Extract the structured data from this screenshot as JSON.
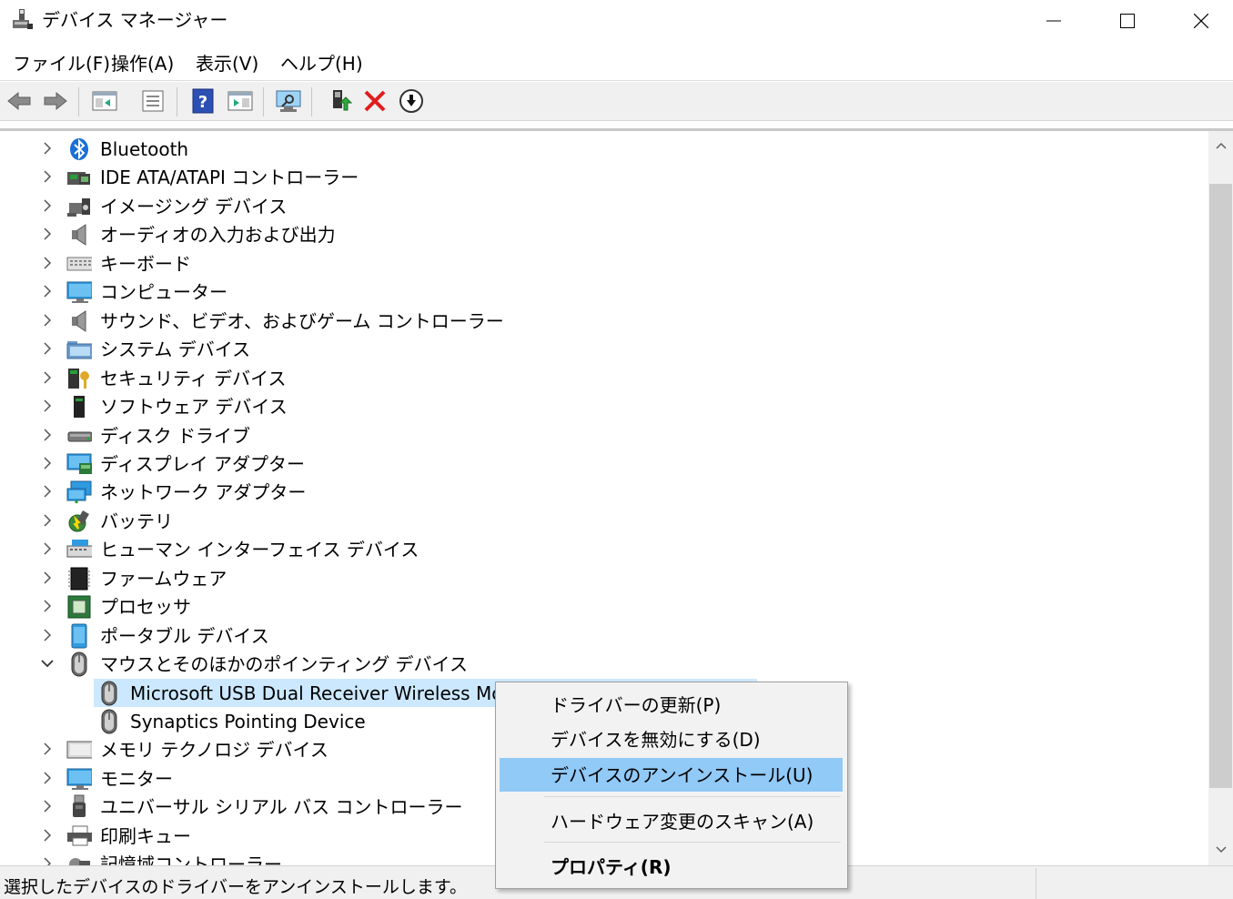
{
  "window": {
    "title": "デバイス マネージャー"
  },
  "menu": [
    "ファイル(F)",
    "操作(A)",
    "表示(V)",
    "ヘルプ(H)"
  ],
  "toolbar": {
    "icons": [
      "back-icon",
      "forward-icon",
      "show-hide-console-tree-icon",
      "properties-icon",
      "help-icon",
      "action-pane-icon",
      "scan-hardware-icon",
      "update-driver-icon",
      "uninstall-icon",
      "disable-device-icon"
    ]
  },
  "tree": {
    "items": [
      {
        "label": "Bluetooth",
        "icon": "bluetooth-icon"
      },
      {
        "label": "IDE ATA/ATAPI コントローラー",
        "icon": "ide-controller-icon"
      },
      {
        "label": "イメージング デバイス",
        "icon": "camera-icon"
      },
      {
        "label": "オーディオの入力および出力",
        "icon": "speaker-icon"
      },
      {
        "label": "キーボード",
        "icon": "keyboard-icon"
      },
      {
        "label": "コンピューター",
        "icon": "computer-icon"
      },
      {
        "label": "サウンド、ビデオ、およびゲーム コントローラー",
        "icon": "speaker-icon"
      },
      {
        "label": "システム デバイス",
        "icon": "system-folder-icon"
      },
      {
        "label": "セキュリティ デバイス",
        "icon": "security-key-icon"
      },
      {
        "label": "ソフトウェア デバイス",
        "icon": "software-device-icon"
      },
      {
        "label": "ディスク ドライブ",
        "icon": "disk-drive-icon"
      },
      {
        "label": "ディスプレイ アダプター",
        "icon": "display-adapter-icon"
      },
      {
        "label": "ネットワーク アダプター",
        "icon": "network-adapter-icon"
      },
      {
        "label": "バッテリ",
        "icon": "battery-icon"
      },
      {
        "label": "ヒューマン インターフェイス デバイス",
        "icon": "hid-icon"
      },
      {
        "label": "ファームウェア",
        "icon": "firmware-chip-icon"
      },
      {
        "label": "プロセッサ",
        "icon": "processor-icon"
      },
      {
        "label": "ポータブル デバイス",
        "icon": "portable-device-icon"
      },
      {
        "label": "マウスとそのほかのポインティング デバイス",
        "icon": "mouse-icon",
        "expanded": true
      },
      {
        "label": "Microsoft USB Dual Receiver Wireless Mouse",
        "icon": "mouse-icon",
        "child": true,
        "selected": true
      },
      {
        "label": "Synaptics Pointing Device",
        "icon": "mouse-icon",
        "child": true
      },
      {
        "label": "メモリ テクノロジ デバイス",
        "icon": "memory-icon"
      },
      {
        "label": "モニター",
        "icon": "monitor-icon"
      },
      {
        "label": "ユニバーサル シリアル バス コントローラー",
        "icon": "usb-icon"
      },
      {
        "label": "印刷キュー",
        "icon": "printer-icon"
      },
      {
        "label": "記憶域コントローラー",
        "icon": "storage-controller-icon"
      }
    ]
  },
  "context_menu": {
    "items": [
      {
        "label": "ドライバーの更新(P)"
      },
      {
        "label": "デバイスを無効にする(D)"
      },
      {
        "label": "デバイスのアンインストール(U)",
        "highlighted": true
      },
      {
        "label": "ハードウェア変更のスキャン(A)"
      },
      {
        "label": "プロパティ(R)",
        "bold": true
      }
    ]
  },
  "status": {
    "text": "選択したデバイスのドライバーをアンインストールします。"
  },
  "colors": {
    "selection": "#cce8ff",
    "menu_highlight": "#91c9f7",
    "toolbar_bg": "#f0f0f0"
  }
}
